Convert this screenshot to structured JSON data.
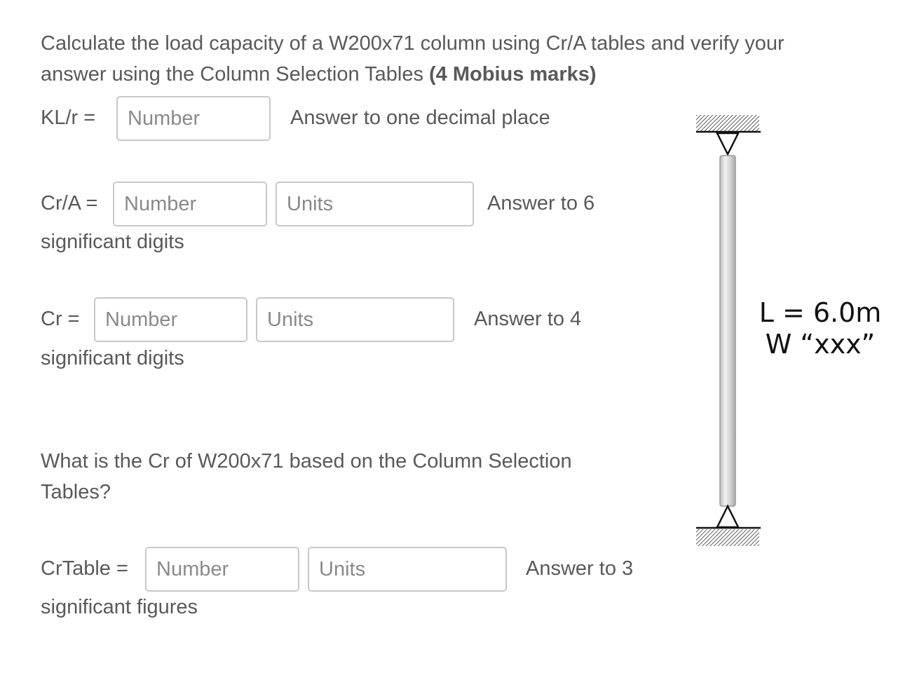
{
  "question": {
    "text_main": "Calculate the load capacity of a W200x71 column using Cr/A tables and verify your answer using the Column Selection Tables",
    "text_marks": "(4 Mobius marks)"
  },
  "klr": {
    "label": "KL/r =",
    "number_placeholder": "Number",
    "hint": "Answer to one decimal place"
  },
  "cra": {
    "label": "Cr/A =",
    "number_placeholder": "Number",
    "units_placeholder": "Units",
    "hint": "Answer to 6",
    "hint_cont": "significant digits"
  },
  "cr": {
    "label": "Cr =",
    "number_placeholder": "Number",
    "units_placeholder": "Units",
    "hint": "Answer to 4",
    "hint_cont": "significant digits"
  },
  "question2": {
    "text": "What is the Cr of W200x71 based on the Column Selection Tables?"
  },
  "crtable": {
    "label": "CrTable =",
    "number_placeholder": "Number",
    "units_placeholder": "Units",
    "hint": "Answer to 3",
    "hint_cont": "significant figures"
  },
  "diagram": {
    "length_label": "L = 6.0m",
    "section_label": "W “xxx”"
  }
}
